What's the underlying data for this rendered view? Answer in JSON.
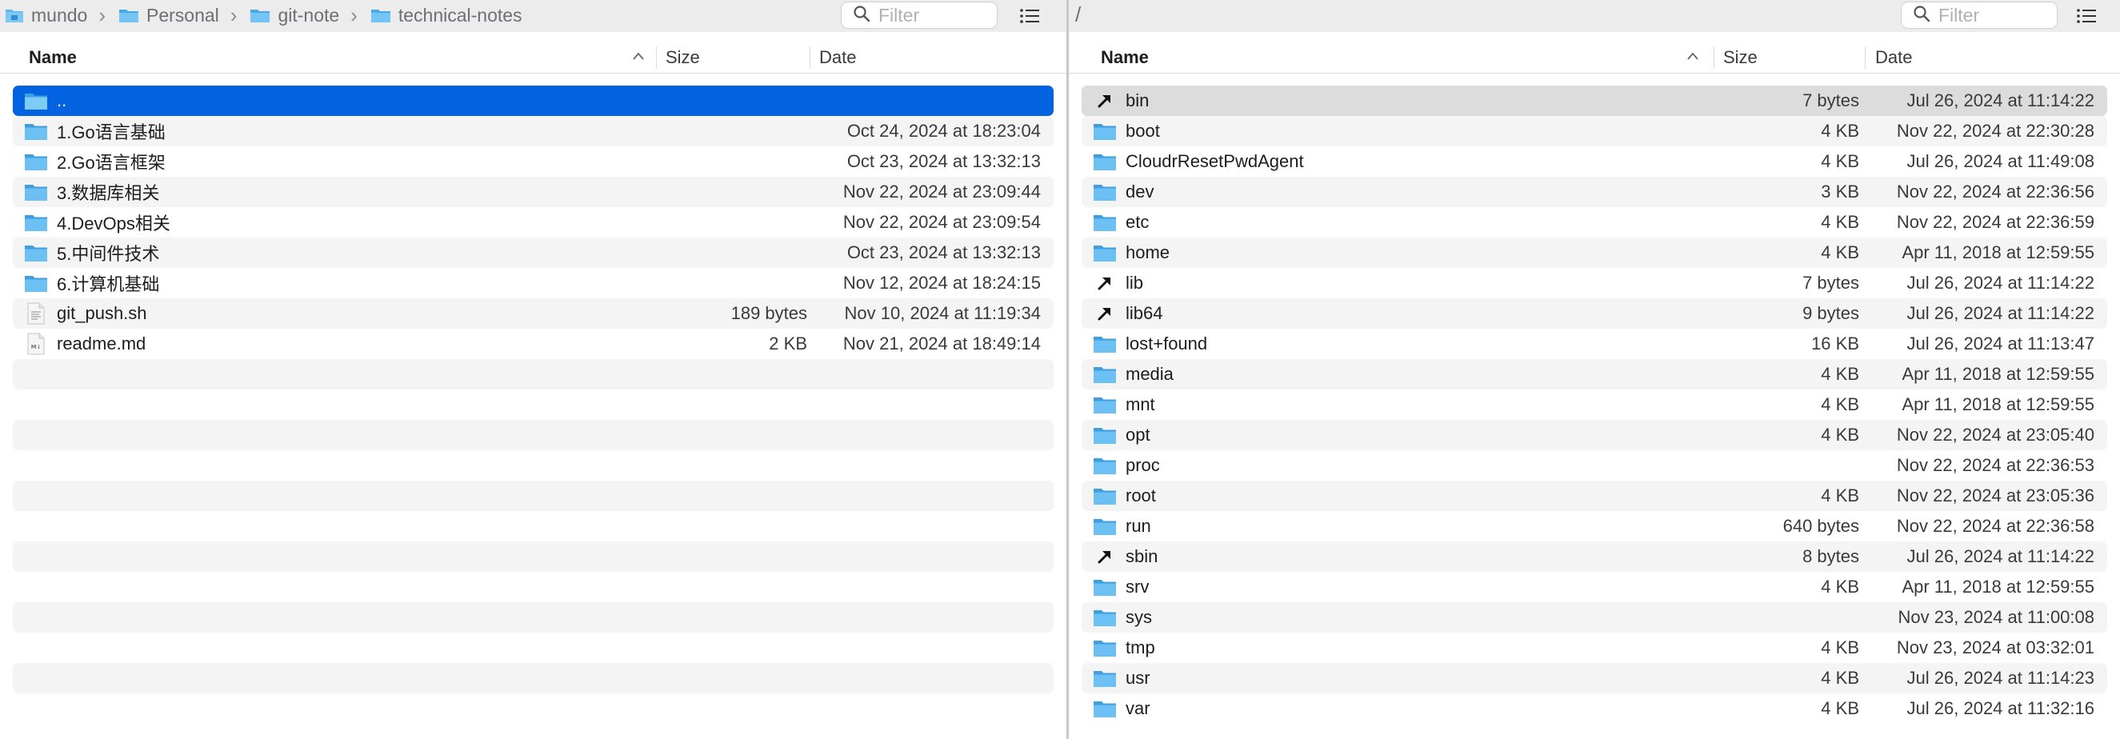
{
  "left_pane": {
    "breadcrumb": [
      {
        "label": "mundo",
        "icon": "home-folder-icon"
      },
      {
        "label": "Personal",
        "icon": "folder-icon"
      },
      {
        "label": "git-note",
        "icon": "folder-icon"
      },
      {
        "label": "technical-notes",
        "icon": "folder-icon"
      }
    ],
    "filter_placeholder": "Filter",
    "columns": {
      "name": "Name",
      "size": "Size",
      "date": "Date"
    },
    "rows": [
      {
        "name": "..",
        "size": "",
        "date": "",
        "kind": "folder",
        "selected": true
      },
      {
        "name": "1.Go语言基础",
        "size": "",
        "date": "Oct 24, 2024 at 18:23:04",
        "kind": "folder"
      },
      {
        "name": "2.Go语言框架",
        "size": "",
        "date": "Oct 23, 2024 at 13:32:13",
        "kind": "folder"
      },
      {
        "name": "3.数据库相关",
        "size": "",
        "date": "Nov 22, 2024 at 23:09:44",
        "kind": "folder"
      },
      {
        "name": "4.DevOps相关",
        "size": "",
        "date": "Nov 22, 2024 at 23:09:54",
        "kind": "folder"
      },
      {
        "name": "5.中间件技术",
        "size": "",
        "date": "Oct 23, 2024 at 13:32:13",
        "kind": "folder"
      },
      {
        "name": "6.计算机基础",
        "size": "",
        "date": "Nov 12, 2024 at 18:24:15",
        "kind": "folder"
      },
      {
        "name": "git_push.sh",
        "size": "189 bytes",
        "date": "Nov 10, 2024 at 11:19:34",
        "kind": "script"
      },
      {
        "name": "readme.md",
        "size": "2 KB",
        "date": "Nov 21, 2024 at 18:49:14",
        "kind": "markdown"
      }
    ],
    "empty_rows": 11
  },
  "right_pane": {
    "path": "/",
    "filter_placeholder": "Filter",
    "columns": {
      "name": "Name",
      "size": "Size",
      "date": "Date"
    },
    "rows": [
      {
        "name": "bin",
        "size": "7 bytes",
        "date": "Jul 26, 2024 at 11:14:22",
        "kind": "alias",
        "highlighted": true
      },
      {
        "name": "boot",
        "size": "4 KB",
        "date": "Nov 22, 2024 at 22:30:28",
        "kind": "folder"
      },
      {
        "name": "CloudrResetPwdAgent",
        "size": "4 KB",
        "date": "Jul 26, 2024 at 11:49:08",
        "kind": "folder"
      },
      {
        "name": "dev",
        "size": "3 KB",
        "date": "Nov 22, 2024 at 22:36:56",
        "kind": "folder"
      },
      {
        "name": "etc",
        "size": "4 KB",
        "date": "Nov 22, 2024 at 22:36:59",
        "kind": "folder"
      },
      {
        "name": "home",
        "size": "4 KB",
        "date": "Apr 11, 2018 at 12:59:55",
        "kind": "folder"
      },
      {
        "name": "lib",
        "size": "7 bytes",
        "date": "Jul 26, 2024 at 11:14:22",
        "kind": "alias"
      },
      {
        "name": "lib64",
        "size": "9 bytes",
        "date": "Jul 26, 2024 at 11:14:22",
        "kind": "alias"
      },
      {
        "name": "lost+found",
        "size": "16 KB",
        "date": "Jul 26, 2024 at 11:13:47",
        "kind": "folder"
      },
      {
        "name": "media",
        "size": "4 KB",
        "date": "Apr 11, 2018 at 12:59:55",
        "kind": "folder"
      },
      {
        "name": "mnt",
        "size": "4 KB",
        "date": "Apr 11, 2018 at 12:59:55",
        "kind": "folder"
      },
      {
        "name": "opt",
        "size": "4 KB",
        "date": "Nov 22, 2024 at 23:05:40",
        "kind": "folder"
      },
      {
        "name": "proc",
        "size": "",
        "date": "Nov 22, 2024 at 22:36:53",
        "kind": "folder"
      },
      {
        "name": "root",
        "size": "4 KB",
        "date": "Nov 22, 2024 at 23:05:36",
        "kind": "folder"
      },
      {
        "name": "run",
        "size": "640 bytes",
        "date": "Nov 22, 2024 at 22:36:58",
        "kind": "folder"
      },
      {
        "name": "sbin",
        "size": "8 bytes",
        "date": "Jul 26, 2024 at 11:14:22",
        "kind": "alias"
      },
      {
        "name": "srv",
        "size": "4 KB",
        "date": "Apr 11, 2018 at 12:59:55",
        "kind": "folder"
      },
      {
        "name": "sys",
        "size": "",
        "date": "Nov 23, 2024 at 11:00:08",
        "kind": "folder"
      },
      {
        "name": "tmp",
        "size": "4 KB",
        "date": "Nov 23, 2024 at 03:32:01",
        "kind": "folder"
      },
      {
        "name": "usr",
        "size": "4 KB",
        "date": "Jul 26, 2024 at 11:14:23",
        "kind": "folder"
      },
      {
        "name": "var",
        "size": "4 KB",
        "date": "Jul 26, 2024 at 11:32:16",
        "kind": "folder"
      }
    ]
  },
  "colors": {
    "selection": "#0463e1",
    "folder": "#5ab8f0",
    "alt_row": "#f4f4f5",
    "highlight": "#dcdcdc"
  }
}
